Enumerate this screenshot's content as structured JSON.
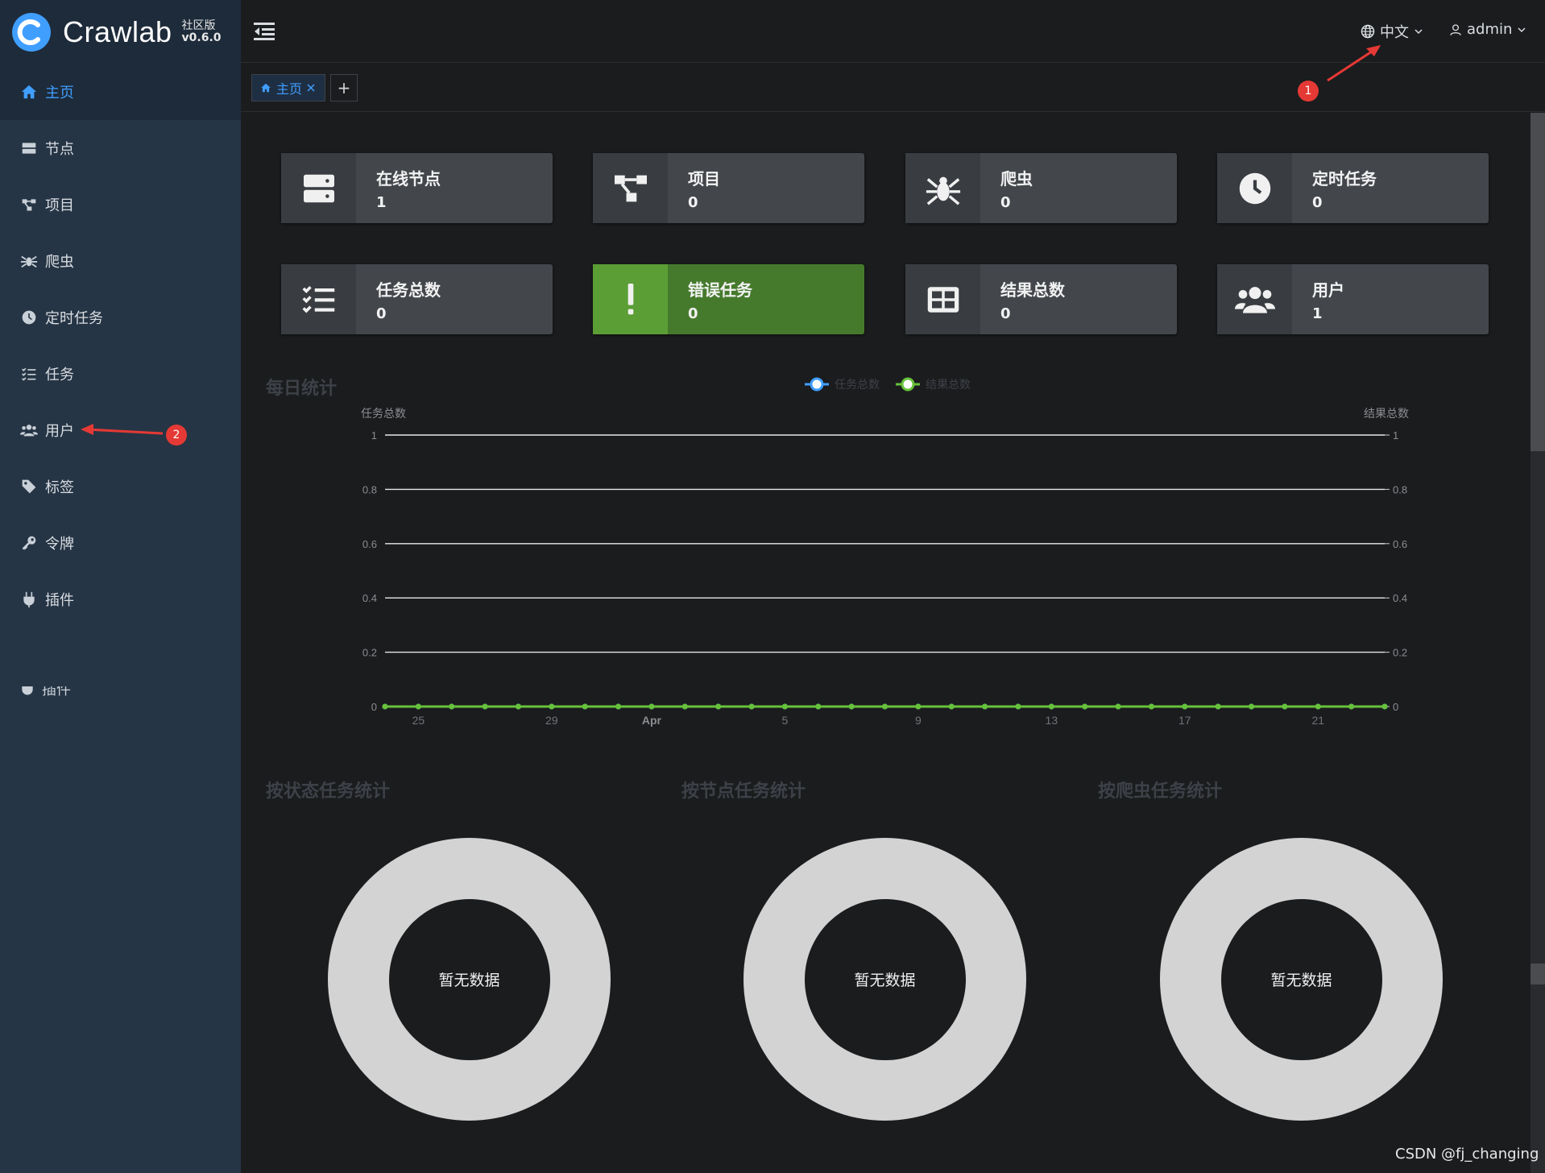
{
  "app": {
    "name": "Crawlab",
    "edition": "社区版",
    "version": "v0.6.0"
  },
  "sidebar": {
    "items": [
      {
        "label": "主页",
        "icon": "home-icon",
        "active": true
      },
      {
        "label": "节点",
        "icon": "server-icon"
      },
      {
        "label": "项目",
        "icon": "project-icon"
      },
      {
        "label": "爬虫",
        "icon": "spider-icon"
      },
      {
        "label": "定时任务",
        "icon": "clock-icon"
      },
      {
        "label": "任务",
        "icon": "tasks-icon"
      },
      {
        "label": "用户",
        "icon": "users-icon"
      },
      {
        "label": "标签",
        "icon": "tag-icon"
      },
      {
        "label": "令牌",
        "icon": "key-icon"
      },
      {
        "label": "插件",
        "icon": "plug-icon"
      }
    ]
  },
  "header": {
    "language": "中文",
    "user": "admin"
  },
  "tabs": {
    "home_label": "主页",
    "add_label": "+"
  },
  "stats": [
    {
      "label": "在线节点",
      "value": "1",
      "icon": "server-icon"
    },
    {
      "label": "项目",
      "value": "0",
      "icon": "project-icon"
    },
    {
      "label": "爬虫",
      "value": "0",
      "icon": "spider-icon"
    },
    {
      "label": "定时任务",
      "value": "0",
      "icon": "clock-icon"
    },
    {
      "label": "任务总数",
      "value": "0",
      "icon": "tasks-icon"
    },
    {
      "label": "错误任务",
      "value": "0",
      "icon": "exclamation-icon",
      "color": "#5a9e35"
    },
    {
      "label": "结果总数",
      "value": "0",
      "icon": "table-icon"
    },
    {
      "label": "用户",
      "value": "1",
      "icon": "users-icon"
    }
  ],
  "daily": {
    "title": "每日统计",
    "legend": [
      "任务总数",
      "结果总数"
    ]
  },
  "chart_data": {
    "type": "line",
    "x": [
      "24",
      "25",
      "26",
      "27",
      "28",
      "29",
      "30",
      "31",
      "Apr",
      "2",
      "3",
      "4",
      "5",
      "6",
      "7",
      "8",
      "9",
      "10",
      "11",
      "12",
      "13",
      "14",
      "15",
      "16",
      "17",
      "18",
      "19",
      "20",
      "21",
      "22",
      "23"
    ],
    "x_tick_labels": [
      "25",
      "29",
      "Apr",
      "5",
      "9",
      "13",
      "17",
      "21"
    ],
    "series": [
      {
        "name": "任务总数",
        "axis": "left",
        "color": "#409eff",
        "values": [
          0,
          0,
          0,
          0,
          0,
          0,
          0,
          0,
          0,
          0,
          0,
          0,
          0,
          0,
          0,
          0,
          0,
          0,
          0,
          0,
          0,
          0,
          0,
          0,
          0,
          0,
          0,
          0,
          0,
          0,
          0
        ]
      },
      {
        "name": "结果总数",
        "axis": "right",
        "color": "#67c23a",
        "values": [
          0,
          0,
          0,
          0,
          0,
          0,
          0,
          0,
          0,
          0,
          0,
          0,
          0,
          0,
          0,
          0,
          0,
          0,
          0,
          0,
          0,
          0,
          0,
          0,
          0,
          0,
          0,
          0,
          0,
          0,
          0
        ]
      }
    ],
    "ylabel_left": "任务总数",
    "ylabel_right": "结果总数",
    "ylim": [
      0,
      1
    ],
    "yticks": [
      "0",
      "0.2",
      "0.4",
      "0.6",
      "0.8",
      "1"
    ],
    "grid": true,
    "legend_position": "top-center"
  },
  "pies": [
    {
      "title": "按状态任务统计",
      "empty_text": "暂无数据"
    },
    {
      "title": "按节点任务统计",
      "empty_text": "暂无数据"
    },
    {
      "title": "按爬虫任务统计",
      "empty_text": "暂无数据"
    }
  ],
  "annotations": [
    "1",
    "2"
  ],
  "watermark": "CSDN @fj_changing",
  "colors": {
    "accent": "#409eff",
    "success": "#67c23a",
    "danger_card": "#5a9e35",
    "sidebar": "#263545"
  }
}
